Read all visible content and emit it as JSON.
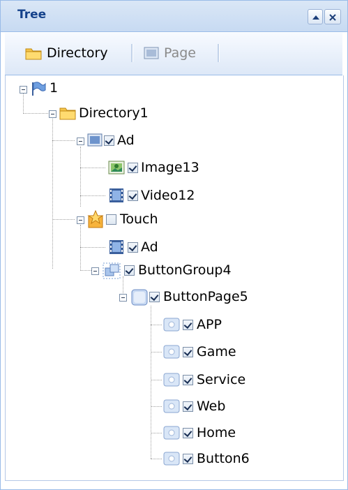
{
  "panel": {
    "title": "Tree"
  },
  "toolbar": {
    "directory_label": "Directory",
    "page_label": "Page"
  },
  "tree": {
    "root": "1",
    "directory1": "Directory1",
    "ad": "Ad",
    "image13": "Image13",
    "video12": "Video12",
    "touch": "Touch",
    "touch_ad": "Ad",
    "buttongroup4": "ButtonGroup4",
    "buttonpage5": "ButtonPage5",
    "buttons": [
      "APP",
      "Game",
      "Service",
      "Web",
      "Home",
      "Button6"
    ]
  },
  "colors": {
    "header_text": "#15428b",
    "border": "#99bbe8",
    "folder": "#f5c44a"
  }
}
